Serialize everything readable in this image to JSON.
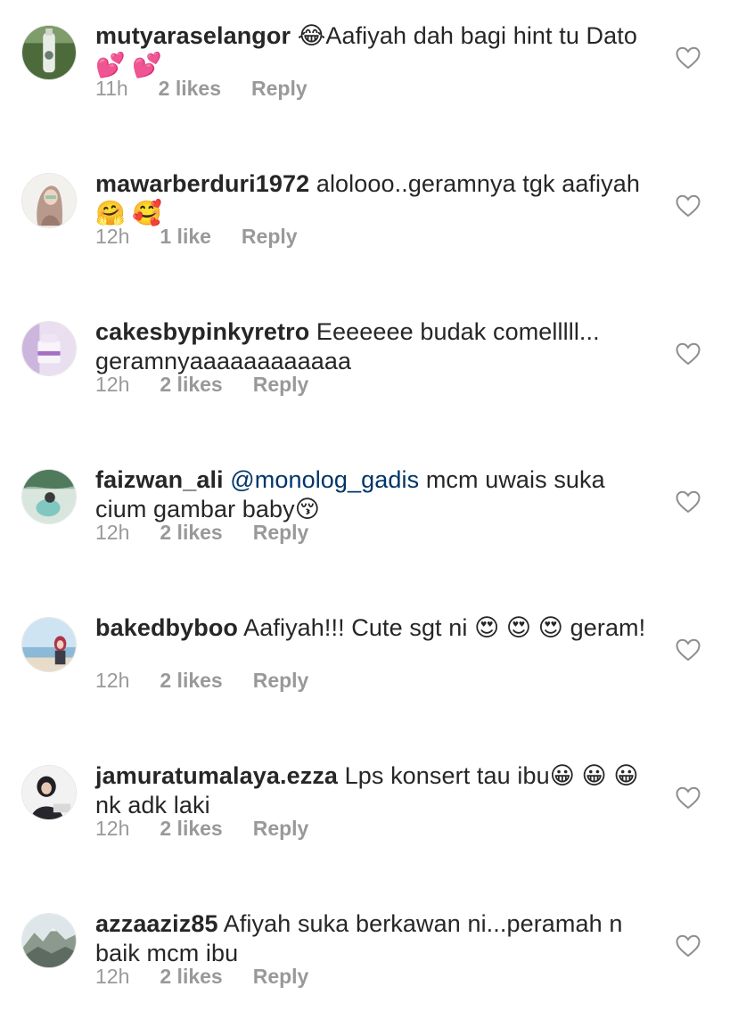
{
  "comments": [
    {
      "username": "mutyaraselangor",
      "text_before": " 😂Aafiyah dah bagi hint tu Dato 💕 💕",
      "mention": "",
      "text_after": "",
      "time": "11h",
      "likes": "2 likes",
      "reply": "Reply",
      "avatar_icon": "bottle-avatar-icon"
    },
    {
      "username": "mawarberduri1972",
      "text_before": " alolooo..geramnya tgk aafiyah🤗 🥰",
      "mention": "",
      "text_after": "",
      "time": "12h",
      "likes": "1 like",
      "reply": "Reply",
      "avatar_icon": "hijab-illustration-avatar-icon"
    },
    {
      "username": "cakesbypinkyretro",
      "text_before": " Eeeeeee budak comelllll... geramnyaaaaaaaaaaaa",
      "mention": "",
      "text_after": "",
      "time": "12h",
      "likes": "2 likes",
      "reply": "Reply",
      "avatar_icon": "cake-avatar-icon"
    },
    {
      "username": "faizwan_ali",
      "text_before": " ",
      "mention": "@monolog_gadis",
      "text_after": "  mcm uwais suka cium gambar baby😚",
      "time": "12h",
      "likes": "2 likes",
      "reply": "Reply",
      "avatar_icon": "outdoor-avatar-icon"
    },
    {
      "username": "bakedbyboo",
      "text_before": " Aafiyah!!! Cute sgt ni 😍 😍 😍 geram!",
      "mention": "",
      "text_after": "",
      "time": "12h",
      "likes": "2 likes",
      "reply": "Reply",
      "avatar_icon": "beach-avatar-icon"
    },
    {
      "username": "jamuratumalaya.ezza",
      "text_before": " Lps konsert tau ibu😀 😀 😀nk adk laki",
      "mention": "",
      "text_after": "",
      "time": "12h",
      "likes": "2 likes",
      "reply": "Reply",
      "avatar_icon": "portrait-avatar-icon"
    },
    {
      "username": "azzaaziz85",
      "text_before": " Afiyah suka berkawan ni...peramah n baik mcm ibu",
      "mention": "",
      "text_after": "",
      "time": "12h",
      "likes": "2 likes",
      "reply": "Reply",
      "avatar_icon": "mountain-avatar-icon"
    }
  ],
  "colors": {
    "text": "#262626",
    "meta": "#999999",
    "mention": "#003569"
  }
}
